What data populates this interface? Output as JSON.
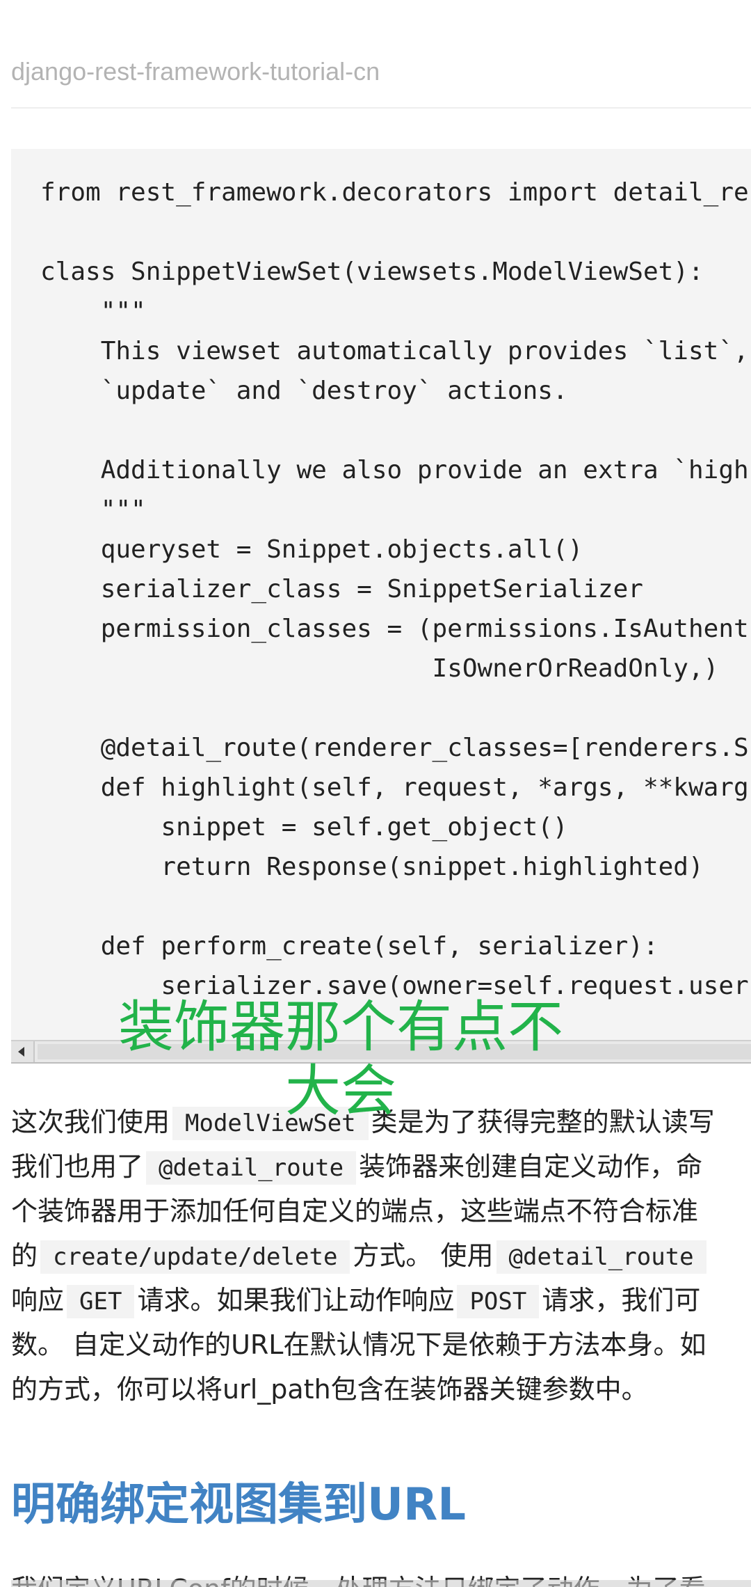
{
  "header": {
    "title": "django-rest-framework-tutorial-cn"
  },
  "code": {
    "lines": [
      "from rest_framework.decorators import detail_re",
      "",
      "class SnippetViewSet(viewsets.ModelViewSet):",
      "    \"\"\"",
      "    This viewset automatically provides `list`,",
      "    `update` and `destroy` actions.",
      "",
      "    Additionally we also provide an extra `high",
      "    \"\"\"",
      "    queryset = Snippet.objects.all()",
      "    serializer_class = SnippetSerializer",
      "    permission_classes = (permissions.IsAuthent",
      "                          IsOwnerOrReadOnly,)",
      "",
      "    @detail_route(renderer_classes=[renderers.S",
      "    def highlight(self, request, *args, **kwarg",
      "        snippet = self.get_object()",
      "        return Response(snippet.highlighted)",
      "",
      "    def perform_create(self, serializer):",
      "        serializer.save(owner=self.request.user"
    ]
  },
  "overlay": {
    "caption": "装饰器那个有点不大会"
  },
  "paragraph": {
    "line1": {
      "t1": "这次我们使用",
      "c1": "ModelViewSet",
      "t2": "类是为了获得完整的默认读写"
    },
    "line2": {
      "t1": "我们也用了",
      "c1": "@detail_route",
      "t2": "装饰器来创建自定义动作，命"
    },
    "line3": {
      "t1": "个装饰器用于添加任何自定义的端点，这些端点不符合标准"
    },
    "line4": {
      "t1": "的",
      "c1": "create/update/delete",
      "t2": "方式。 使用",
      "c2": "@detail_route"
    },
    "line5": {
      "t1": "响应",
      "c1": "GET",
      "t2": "请求。如果我们让动作响应",
      "c2": "POST",
      "t3": "请求，我们可"
    },
    "line6": {
      "t1": "数。 自定义动作的URL在默认情况下是依赖于方法本身。如"
    },
    "line7": {
      "t1": "的方式，你可以将url_path包含在装饰器关键参数中。"
    }
  },
  "section": {
    "heading": "明确绑定视图集到URL"
  },
  "bottom": {
    "text": "我们定义URLConf的时候，处理方法只绑定了动作。为了看"
  }
}
